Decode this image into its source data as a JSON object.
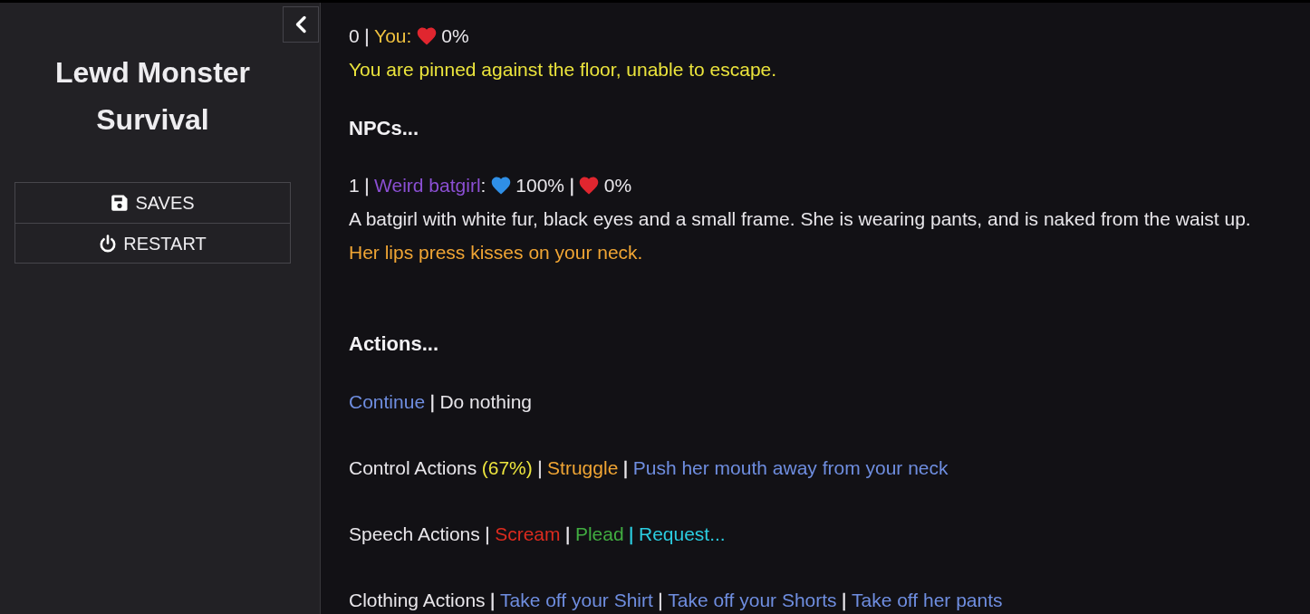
{
  "sidebar": {
    "title": "Lewd Monster Survival",
    "menu": [
      {
        "kind": "saves",
        "label": "SAVES"
      },
      {
        "kind": "restart",
        "label": "RESTART"
      }
    ]
  },
  "player": {
    "index": "0",
    "separator": {
      "text": "|"
    },
    "name": {
      "text": "You:",
      "color": "#f1c23f"
    },
    "stats": [
      {
        "color": "#e0262f",
        "value": "0%"
      }
    ],
    "status": {
      "text": "You are pinned against the floor, unable to escape.",
      "color": "#ebe43c"
    }
  },
  "npcs_heading": "NPCs...",
  "npcs": [
    {
      "index": "1",
      "separator": {
        "text": "|"
      },
      "name": {
        "text": "Weird batgirl",
        "color": "#8b4fd3"
      },
      "name_suffix": ":",
      "stats": [
        {
          "color": "#2f8fe6",
          "value": "100%"
        },
        {
          "separator": {
            "text": "|"
          },
          "color": "#e0262f",
          "value": "0%"
        }
      ],
      "description": "A batgirl with white fur, black eyes and a small frame. She is wearing pants, and is naked from the waist up.",
      "action": {
        "text": "Her lips press kisses on your neck.",
        "color": "#f0a534"
      }
    }
  ],
  "actions_heading": "Actions...",
  "action_rows": [
    {
      "options": [
        {
          "text": "Continue",
          "color": "#6f8ee0"
        },
        {
          "separator": {
            "text": "|"
          },
          "text": "Do nothing",
          "color": "#e8e6ea"
        }
      ]
    },
    {
      "label": "Control Actions",
      "chance": {
        "text": "(67%)",
        "color": "#ece43e"
      },
      "options": [
        {
          "separator": {
            "text": "|"
          },
          "text": "Struggle",
          "color": "#f0a534"
        },
        {
          "separator": {
            "text": "|"
          },
          "text": "Push her mouth away from your neck",
          "color": "#6f8ee0"
        }
      ]
    },
    {
      "label": "Speech Actions",
      "options": [
        {
          "separator": {
            "text": "|"
          },
          "text": "Scream",
          "color": "#dc2b1f"
        },
        {
          "separator": {
            "text": "|"
          },
          "text": "Plead",
          "color": "#41ad41"
        },
        {
          "separator": {
            "text": "|",
            "color": "#2bcde0"
          },
          "text": "Request...",
          "color": "#2bcde0"
        }
      ]
    },
    {
      "label": "Clothing Actions",
      "options": [
        {
          "separator": {
            "text": "|"
          },
          "text": "Take off your Shirt",
          "color": "#6f8ee0"
        },
        {
          "separator": {
            "text": "|"
          },
          "text": "Take off your Shorts",
          "color": "#6f8ee0"
        },
        {
          "separator": {
            "text": "|"
          },
          "text": "Take off her pants",
          "color": "#6f8ee0"
        }
      ]
    }
  ]
}
